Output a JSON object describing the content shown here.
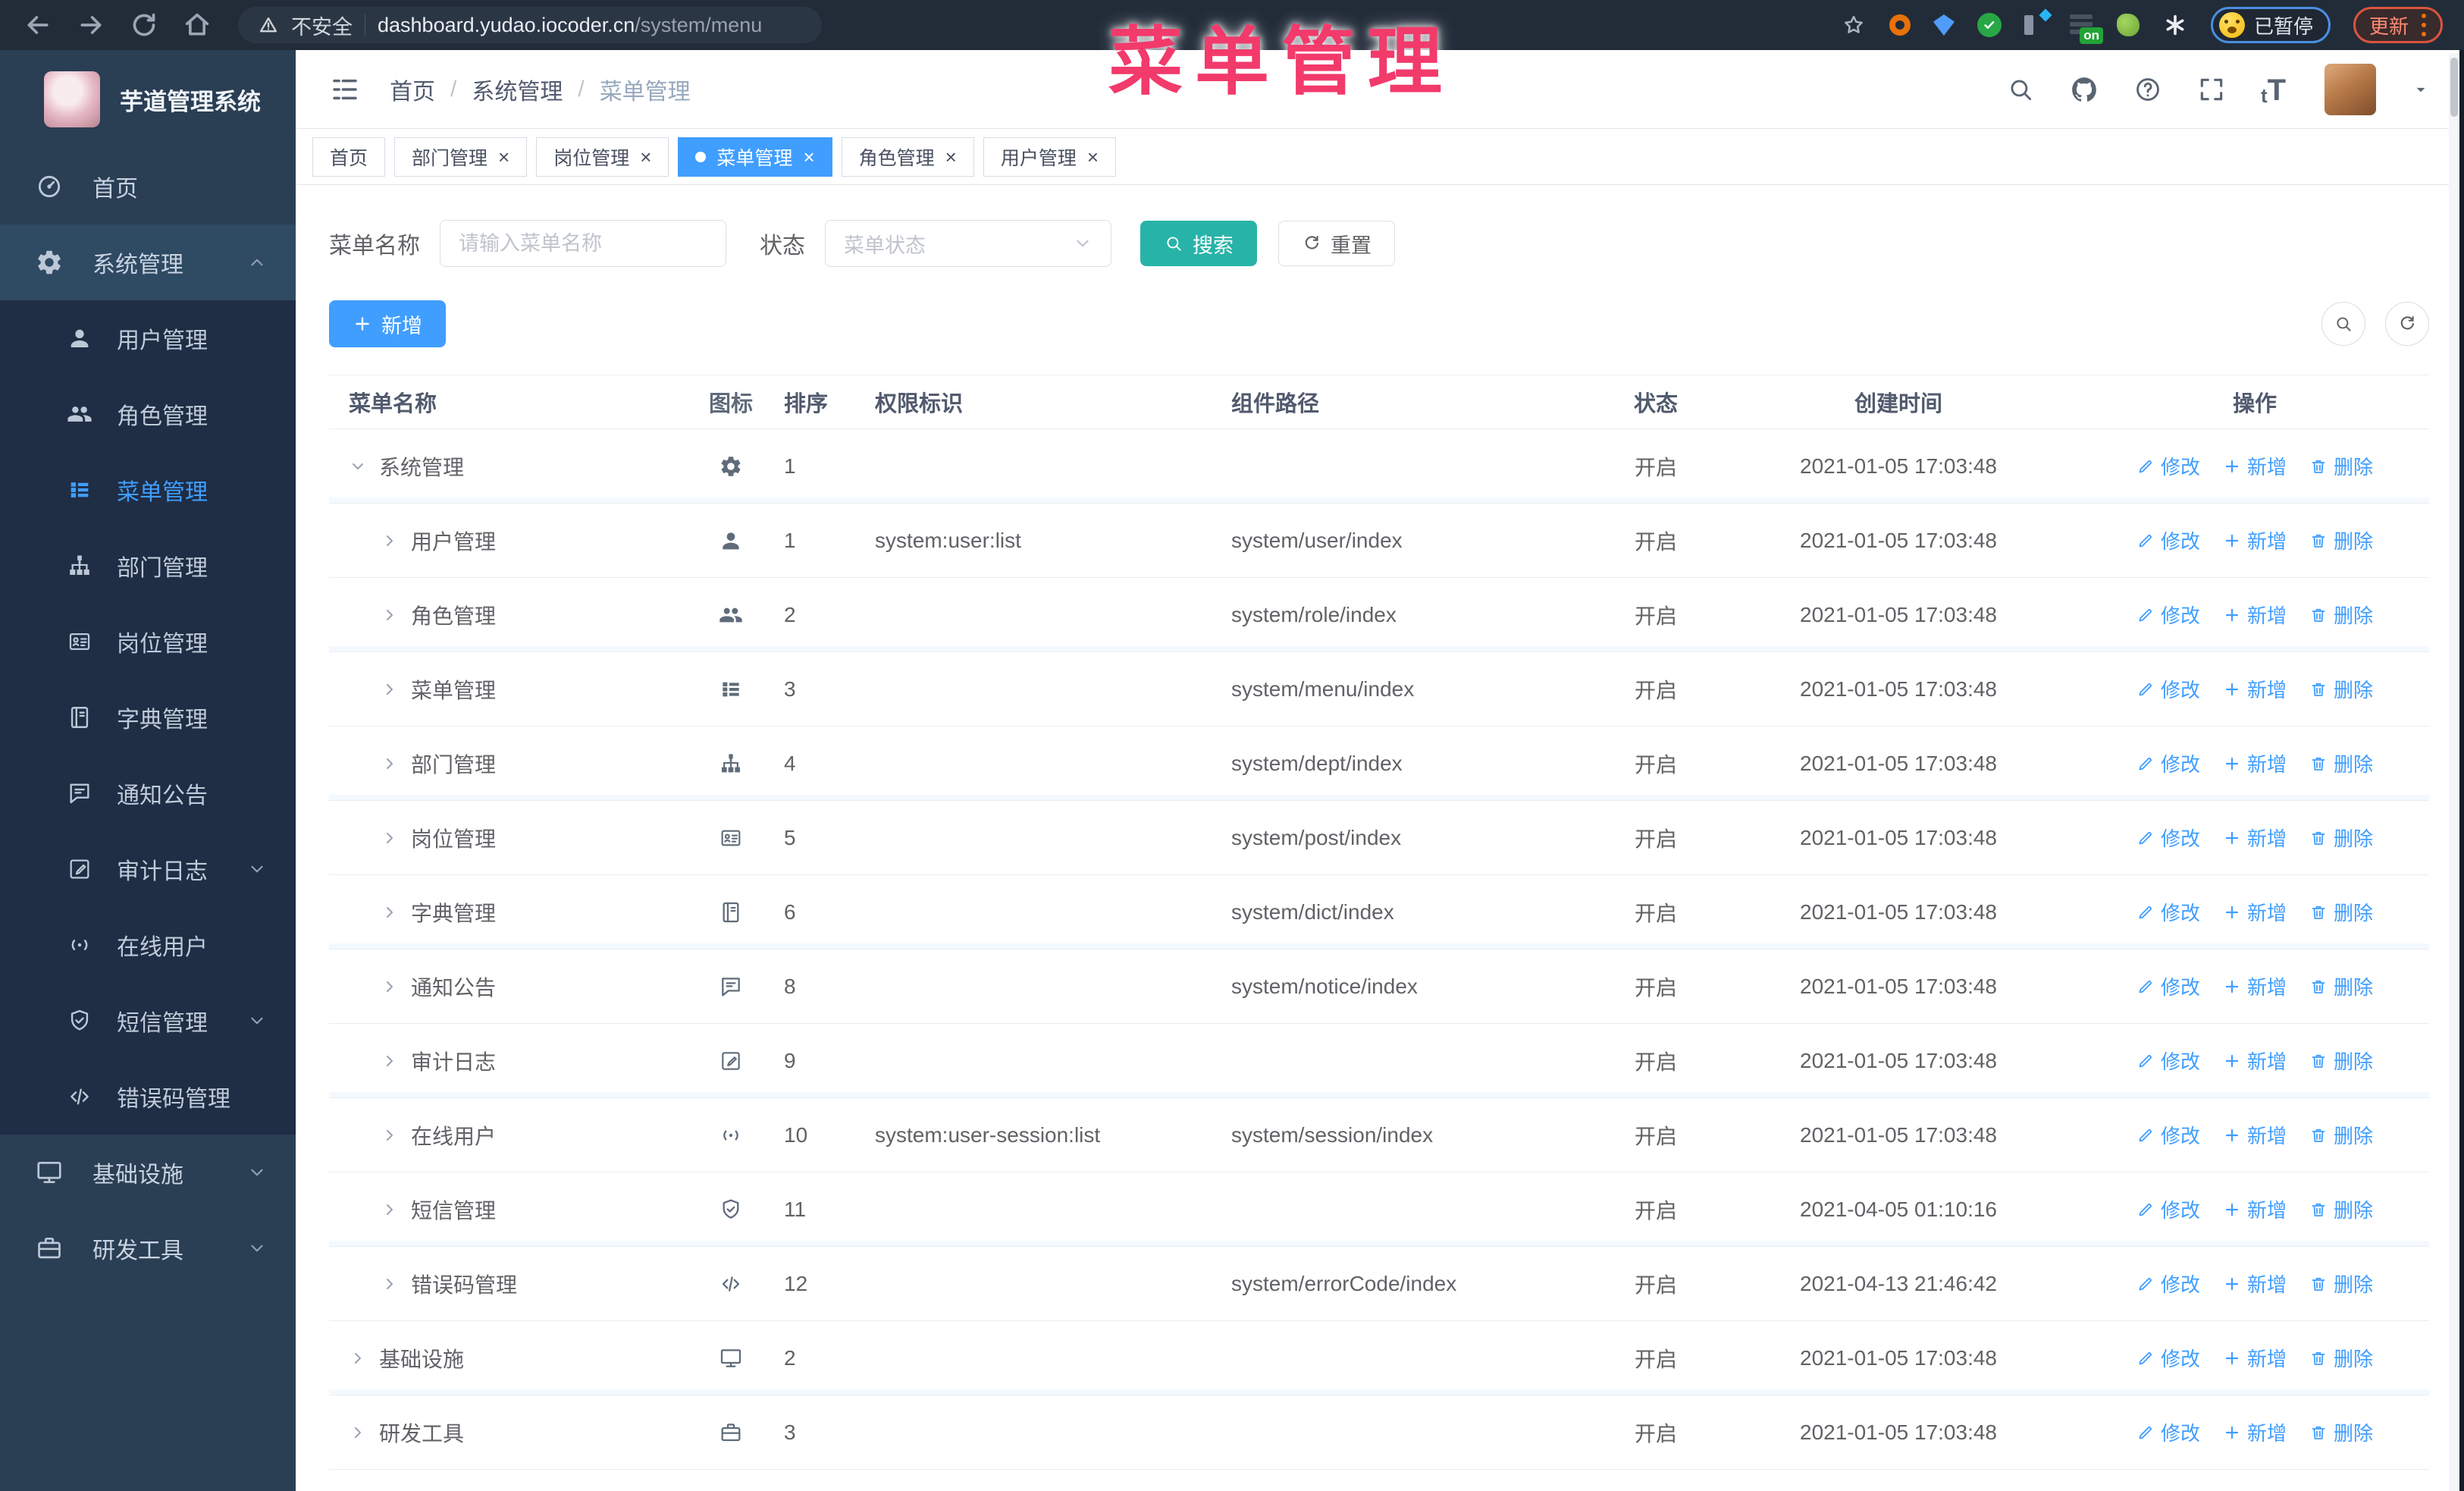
{
  "browser": {
    "security_label": "不安全",
    "url_host": "dashboard.yudao.iocoder.cn",
    "url_path": "/system/menu",
    "on_badge": "on",
    "paused_badge": "已暂停",
    "update_label": "更新"
  },
  "annotation": {
    "text": "菜单管理",
    "color": "#f23a6b"
  },
  "sidebar": {
    "title": "芋道管理系统",
    "items": [
      {
        "label": "首页",
        "icon": "dashboard-icon",
        "level": 0
      },
      {
        "label": "系统管理",
        "icon": "gear-icon",
        "level": 0,
        "chevron": "up",
        "expanded": true
      },
      {
        "label": "用户管理",
        "icon": "user-icon",
        "level": 1
      },
      {
        "label": "角色管理",
        "icon": "users-icon",
        "level": 1
      },
      {
        "label": "菜单管理",
        "icon": "menu-icon",
        "level": 1,
        "active": true
      },
      {
        "label": "部门管理",
        "icon": "tree-icon",
        "level": 1
      },
      {
        "label": "岗位管理",
        "icon": "badge-icon",
        "level": 1
      },
      {
        "label": "字典管理",
        "icon": "dict-icon",
        "level": 1
      },
      {
        "label": "通知公告",
        "icon": "notice-icon",
        "level": 1
      },
      {
        "label": "审计日志",
        "icon": "log-icon",
        "level": 1,
        "chevron": "down"
      },
      {
        "label": "在线用户",
        "icon": "online-icon",
        "level": 1
      },
      {
        "label": "短信管理",
        "icon": "sms-icon",
        "level": 1,
        "chevron": "down"
      },
      {
        "label": "错误码管理",
        "icon": "code-icon",
        "level": 1
      },
      {
        "label": "基础设施",
        "icon": "infra-icon",
        "level": 0,
        "chevron": "down"
      },
      {
        "label": "研发工具",
        "icon": "tool-icon",
        "level": 0,
        "chevron": "down"
      }
    ]
  },
  "header": {
    "breadcrumb": [
      "首页",
      "系统管理",
      "菜单管理"
    ],
    "icons": [
      "search-icon",
      "github-icon",
      "question-icon",
      "fullscreen-icon",
      "fontsize-icon"
    ]
  },
  "tabs": [
    {
      "label": "首页",
      "closable": false,
      "active": false
    },
    {
      "label": "部门管理",
      "closable": true,
      "active": false
    },
    {
      "label": "岗位管理",
      "closable": true,
      "active": false
    },
    {
      "label": "菜单管理",
      "closable": true,
      "active": true
    },
    {
      "label": "角色管理",
      "closable": true,
      "active": false
    },
    {
      "label": "用户管理",
      "closable": true,
      "active": false
    }
  ],
  "filters": {
    "name_label": "菜单名称",
    "name_placeholder": "请输入菜单名称",
    "status_label": "状态",
    "status_placeholder": "菜单状态",
    "search_label": "搜索",
    "reset_label": "重置"
  },
  "toolbar": {
    "add_label": "新增"
  },
  "table": {
    "columns": [
      "菜单名称",
      "图标",
      "排序",
      "权限标识",
      "组件路径",
      "状态",
      "创建时间",
      "操作"
    ],
    "row_actions": [
      {
        "label": "修改",
        "icon": "edit-icon"
      },
      {
        "label": "新增",
        "icon": "plus-icon"
      },
      {
        "label": "删除",
        "icon": "delete-icon"
      }
    ],
    "rows": [
      {
        "name": "系统管理",
        "icon": "gear-icon",
        "level": 0,
        "expanded": true,
        "sort": "1",
        "perm": "",
        "component": "",
        "status": "开启",
        "time": "2021-01-05 17:03:48"
      },
      {
        "name": "用户管理",
        "icon": "user-icon",
        "level": 1,
        "expanded": false,
        "sort": "1",
        "perm": "system:user:list",
        "component": "system/user/index",
        "status": "开启",
        "time": "2021-01-05 17:03:48"
      },
      {
        "name": "角色管理",
        "icon": "users-icon",
        "level": 1,
        "expanded": false,
        "sort": "2",
        "perm": "",
        "component": "system/role/index",
        "status": "开启",
        "time": "2021-01-05 17:03:48"
      },
      {
        "name": "菜单管理",
        "icon": "menu-icon",
        "level": 1,
        "expanded": false,
        "sort": "3",
        "perm": "",
        "component": "system/menu/index",
        "status": "开启",
        "time": "2021-01-05 17:03:48"
      },
      {
        "name": "部门管理",
        "icon": "tree-icon",
        "level": 1,
        "expanded": false,
        "sort": "4",
        "perm": "",
        "component": "system/dept/index",
        "status": "开启",
        "time": "2021-01-05 17:03:48"
      },
      {
        "name": "岗位管理",
        "icon": "badge-icon",
        "level": 1,
        "expanded": false,
        "sort": "5",
        "perm": "",
        "component": "system/post/index",
        "status": "开启",
        "time": "2021-01-05 17:03:48"
      },
      {
        "name": "字典管理",
        "icon": "dict-icon",
        "level": 1,
        "expanded": false,
        "sort": "6",
        "perm": "",
        "component": "system/dict/index",
        "status": "开启",
        "time": "2021-01-05 17:03:48"
      },
      {
        "name": "通知公告",
        "icon": "notice-icon",
        "level": 1,
        "expanded": false,
        "sort": "8",
        "perm": "",
        "component": "system/notice/index",
        "status": "开启",
        "time": "2021-01-05 17:03:48"
      },
      {
        "name": "审计日志",
        "icon": "log-icon",
        "level": 1,
        "expanded": false,
        "sort": "9",
        "perm": "",
        "component": "",
        "status": "开启",
        "time": "2021-01-05 17:03:48"
      },
      {
        "name": "在线用户",
        "icon": "online-icon",
        "level": 1,
        "expanded": false,
        "sort": "10",
        "perm": "system:user-session:list",
        "component": "system/session/index",
        "status": "开启",
        "time": "2021-01-05 17:03:48"
      },
      {
        "name": "短信管理",
        "icon": "sms-icon",
        "level": 1,
        "expanded": false,
        "sort": "11",
        "perm": "",
        "component": "",
        "status": "开启",
        "time": "2021-04-05 01:10:16"
      },
      {
        "name": "错误码管理",
        "icon": "code-icon",
        "level": 1,
        "expanded": false,
        "sort": "12",
        "perm": "",
        "component": "system/errorCode/index",
        "status": "开启",
        "time": "2021-04-13 21:46:42"
      },
      {
        "name": "基础设施",
        "icon": "infra-icon",
        "level": 0,
        "expanded": false,
        "sort": "2",
        "perm": "",
        "component": "",
        "status": "开启",
        "time": "2021-01-05 17:03:48"
      },
      {
        "name": "研发工具",
        "icon": "tool-icon",
        "level": 0,
        "expanded": false,
        "sort": "3",
        "perm": "",
        "component": "",
        "status": "开启",
        "time": "2021-01-05 17:03:48"
      }
    ]
  },
  "colors": {
    "accent_blue": "#409eff",
    "search_teal": "#28b3a8",
    "annotation_pink": "#f23a6b",
    "sidebar_bg": "#2a3e54",
    "submenu_bg": "#1f2d45",
    "chrome_bg": "#222c39"
  }
}
